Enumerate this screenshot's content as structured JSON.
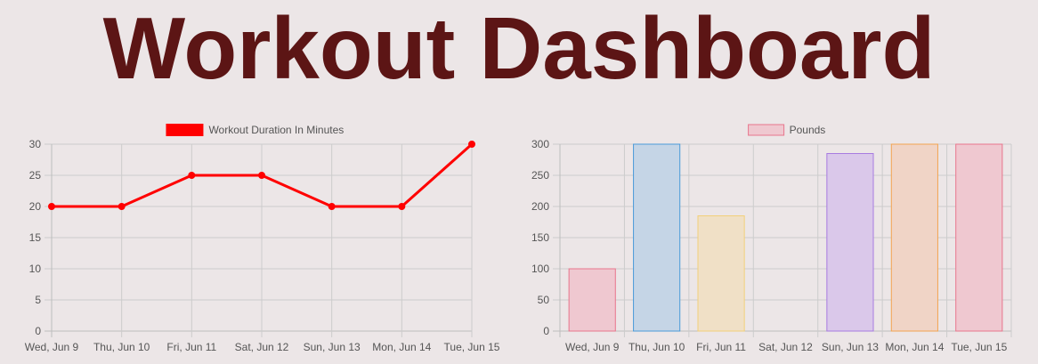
{
  "page": {
    "title": "Workout Dashboard"
  },
  "chart_data": [
    {
      "type": "line",
      "legend": "Workout Duration In Minutes",
      "legend_position": "top",
      "categories": [
        "Wed, Jun 9",
        "Thu, Jun 10",
        "Fri, Jun 11",
        "Sat, Jun 12",
        "Sun, Jun 13",
        "Mon, Jun 14",
        "Tue, Jun 15"
      ],
      "series": [
        {
          "name": "Workout Duration In Minutes",
          "values": [
            20,
            20,
            25,
            25,
            20,
            20,
            30
          ],
          "color": "#ff0000"
        }
      ],
      "yticks": [
        0,
        5,
        10,
        15,
        20,
        25,
        30
      ],
      "ylim": [
        0,
        30
      ],
      "grid": true
    },
    {
      "type": "bar",
      "legend": "Pounds",
      "legend_position": "top",
      "categories": [
        "Wed, Jun 9",
        "Thu, Jun 10",
        "Fri, Jun 11",
        "Sat, Jun 12",
        "Sun, Jun 13",
        "Mon, Jun 14",
        "Tue, Jun 15"
      ],
      "series": [
        {
          "name": "Pounds",
          "values": [
            100,
            300,
            185,
            0,
            285,
            300,
            300
          ]
        }
      ],
      "bar_fills": [
        "#efc8d0",
        "#c5d5e6",
        "#f0e0c6",
        "#d2e6e4",
        "#dac8ea",
        "#f0d4c6",
        "#efc8d0"
      ],
      "bar_borders": [
        "#e8758c",
        "#4a9ad8",
        "#f2d07a",
        "#5cc0c0",
        "#a77be0",
        "#f2a450",
        "#e8758c"
      ],
      "legend_fill": "#efc8d0",
      "legend_border": "#e8758c",
      "yticks": [
        0,
        50,
        100,
        150,
        200,
        250,
        300
      ],
      "ylim": [
        0,
        300
      ],
      "grid": true
    }
  ]
}
